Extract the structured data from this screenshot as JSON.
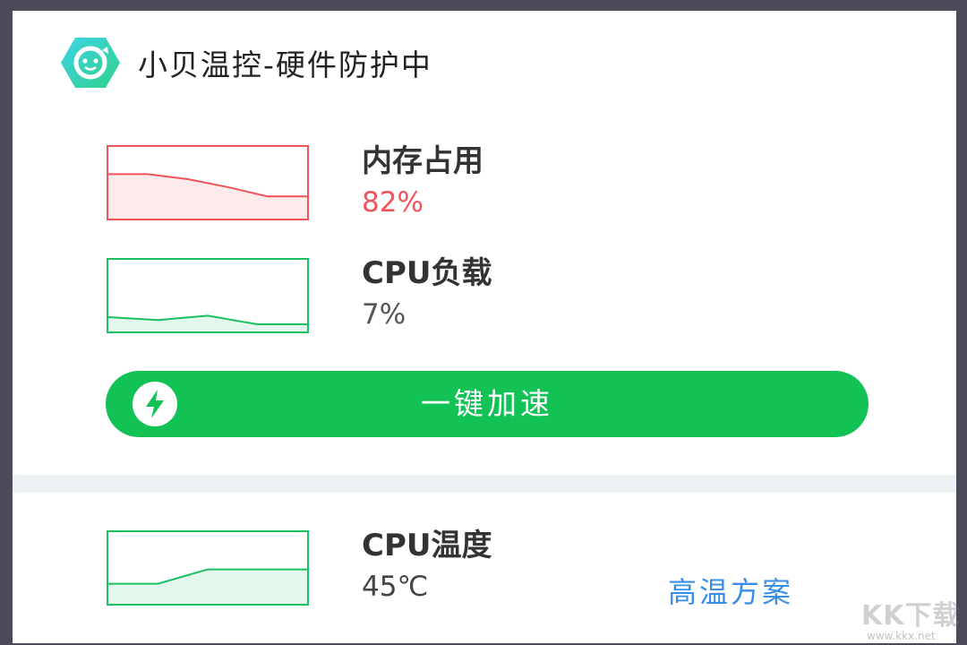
{
  "app": {
    "title": "小贝温控-硬件防护中",
    "logo_icon": "smiley-refresh-icon"
  },
  "stats": {
    "memory": {
      "label": "内存占用",
      "value": "82%",
      "value_color": "#f0545a",
      "chart_color": "#f0545a",
      "series": [
        0.62,
        0.62,
        0.55,
        0.44,
        0.31,
        0.31
      ]
    },
    "cpu_load": {
      "label": "CPU负载",
      "value": "7%",
      "value_color": "#555555",
      "chart_color": "#18c060",
      "series": [
        0.2,
        0.16,
        0.22,
        0.1,
        0.1
      ]
    },
    "cpu_temp": {
      "label": "CPU温度",
      "value": "45℃",
      "value_color": "#444444",
      "chart_color": "#18c060",
      "series": [
        0.28,
        0.28,
        0.48,
        0.48,
        0.48
      ]
    }
  },
  "boost_button": {
    "label": "一键加速",
    "icon": "lightning-icon",
    "color": "#13c255"
  },
  "high_temp_link": {
    "label": "高温方案",
    "color": "#3a8ee6"
  },
  "watermark": {
    "main": "KK下载",
    "sub": "www.kkx.net"
  }
}
